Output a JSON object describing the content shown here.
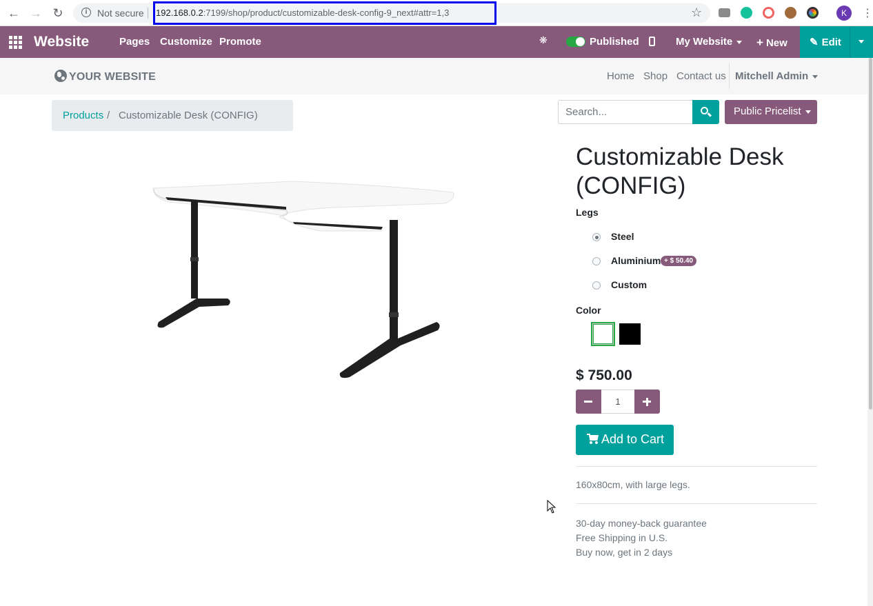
{
  "browser": {
    "security_label": "Not secure",
    "url_host": "192.168.0.2",
    "url_path": ":7199/shop/product/customizable-desk-config-9_next#attr=1,3",
    "profile_initial": "K",
    "icons": [
      "back-icon",
      "forward-icon",
      "reload-icon",
      "info-icon",
      "star-icon",
      "camera-icon",
      "grammarly-icon",
      "lens-icon",
      "monkey-icon",
      "color-picker-icon",
      "kebab-menu-icon"
    ]
  },
  "topbar": {
    "brand": "Website",
    "menus": [
      "Pages",
      "Customize",
      "Promote"
    ],
    "published_label": "Published",
    "my_website_label": "My Website",
    "new_label": "New",
    "edit_label": "Edit",
    "accent": "#875a7b",
    "teal": "#00a09d"
  },
  "site_header": {
    "logo": "YOUR WEBSITE",
    "menu": [
      "Home",
      "Shop",
      "Contact us"
    ],
    "user": "Mitchell Admin"
  },
  "breadcrumb": {
    "parent": "Products",
    "separator": "/",
    "current": "Customizable Desk (CONFIG)"
  },
  "search": {
    "placeholder": "Search..."
  },
  "pricelist": {
    "label": "Public Pricelist"
  },
  "product": {
    "name": "Customizable Desk (CONFIG)",
    "legs_label": "Legs",
    "legs_options": [
      {
        "label": "Steel",
        "selected": true
      },
      {
        "label": "Aluminium",
        "extra": "+ $ 50.40",
        "selected": false
      },
      {
        "label": "Custom",
        "selected": false
      }
    ],
    "color_label": "Color",
    "color_options": [
      {
        "color": "#ffffff",
        "selected": true
      },
      {
        "color": "#000000",
        "selected": false
      }
    ],
    "price": "$ 750.00",
    "quantity": "1",
    "add_to_cart": "Add to Cart",
    "description": "160x80cm, with large legs.",
    "terms": [
      "30-day money-back guarantee",
      "Free Shipping in U.S.",
      "Buy now, get in 2 days"
    ]
  }
}
